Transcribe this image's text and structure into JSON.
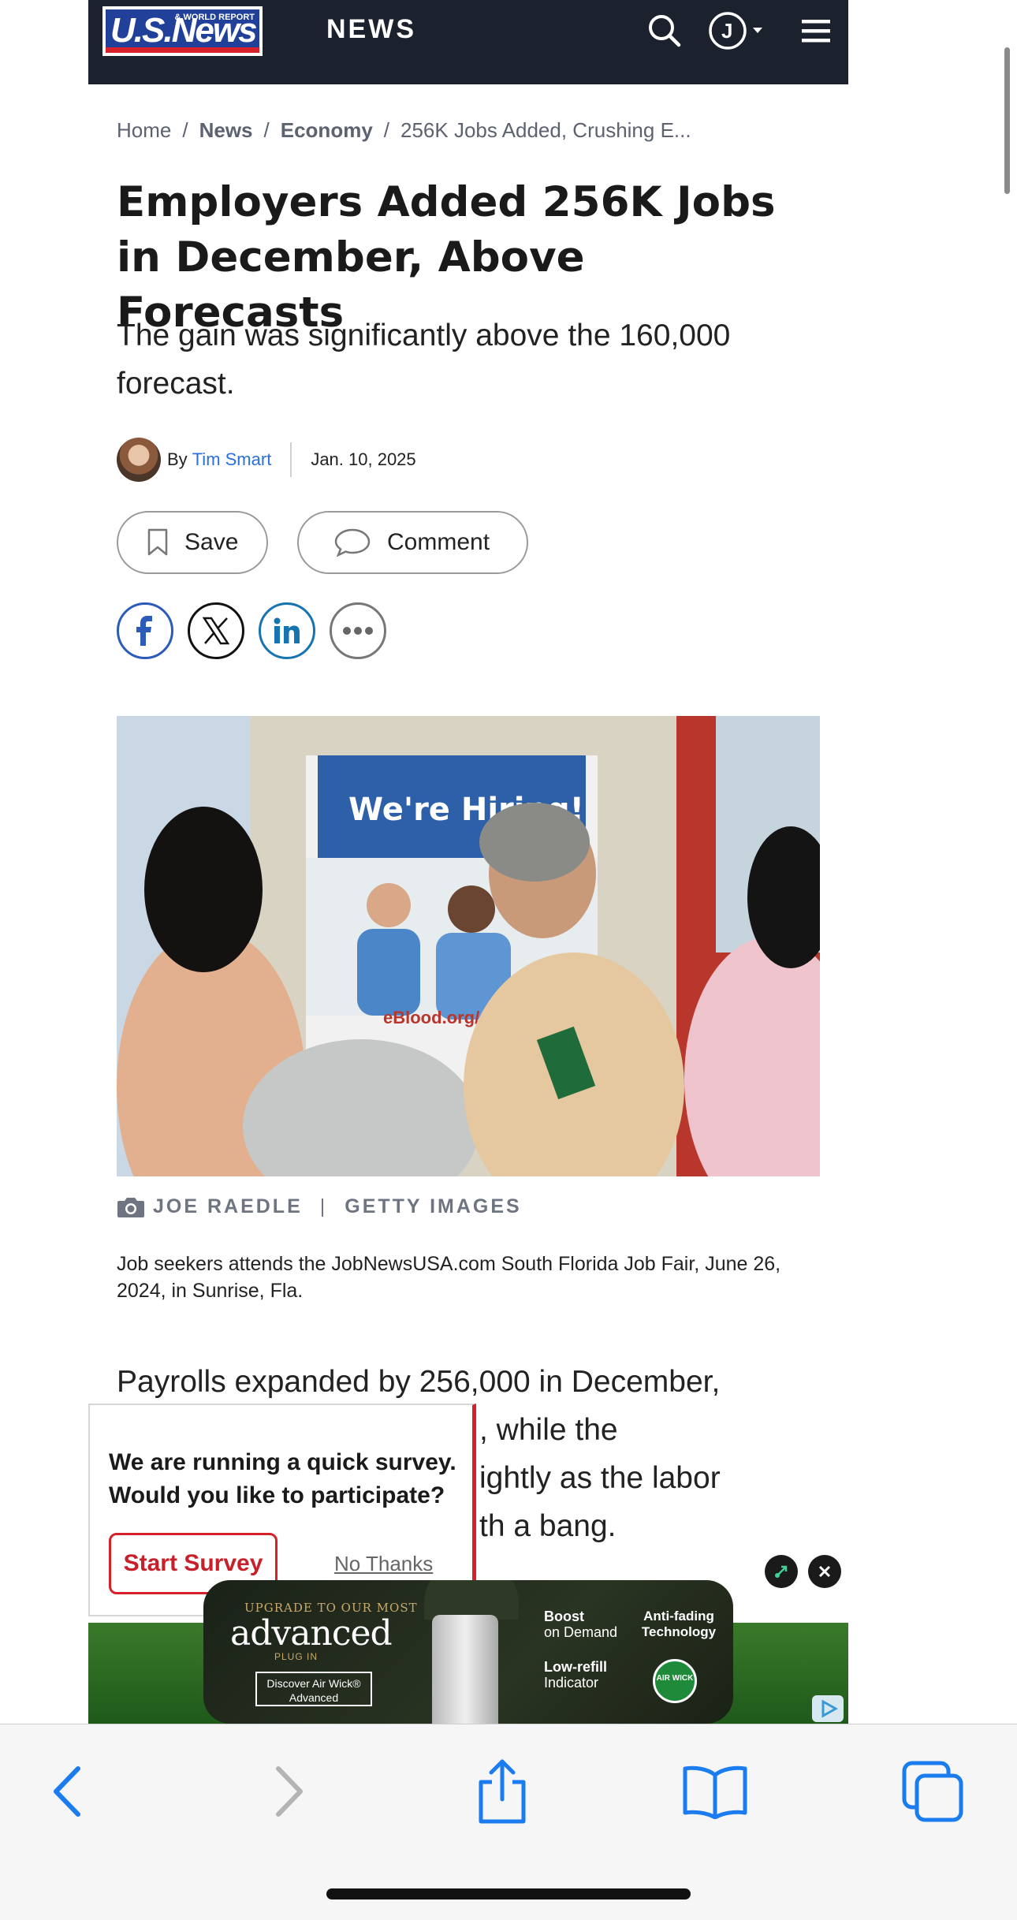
{
  "header": {
    "logo_text": "U.S.News",
    "logo_subtext": "& WORLD REPORT",
    "section": "NEWS",
    "account_initial": "J",
    "icons": [
      "search-icon",
      "account-icon",
      "menu-icon"
    ]
  },
  "breadcrumb": {
    "items": [
      "Home",
      "News",
      "Economy",
      "256K Jobs Added, Crushing E..."
    ],
    "separator": "/"
  },
  "article": {
    "headline": "Employers Added 256K Jobs in December, Above Forecasts",
    "dek": "The gain was significantly above the 160,000 forecast.",
    "byline_prefix": "By",
    "author": "Tim Smart",
    "date": "Jan. 10, 2025",
    "save_label": "Save",
    "comment_label": "Comment",
    "share_icons": [
      "facebook-icon",
      "x-icon",
      "linkedin-icon",
      "more-icon"
    ],
    "image_credit_photographer": "JOE RAEDLE",
    "image_credit_agency": "GETTY IMAGES",
    "image_banner_text": "We're Hiring!",
    "image_sign_text": "eBlood.org/careers",
    "caption": "Job seekers attends the JobNewsUSA.com South Florida Job Fair, June 26, 2024, in Sunrise, Fla.",
    "body_line1": "Payrolls expanded by 256,000 in December,",
    "body_line2": ", while the",
    "body_line3": "ightly as the labor",
    "body_line4": "th a bang."
  },
  "survey": {
    "question": "We are running a quick survey. Would you like to participate?",
    "start_label": "Start Survey",
    "no_thanks_label": "No Thanks"
  },
  "ad": {
    "line1": "UPGRADE TO OUR MOST",
    "line2": "advanced",
    "line3": "PLUG IN",
    "button": "Discover Air Wick® Advanced",
    "feature1_title": "Boost",
    "feature1_sub": "on Demand",
    "feature2_title": "Low-refill",
    "feature2_sub": "Indicator",
    "feature3": "Anti-fading Technology",
    "brand": "AIR WICK"
  },
  "colors": {
    "header_bg": "#1c212e",
    "link_blue": "#2a6fdb",
    "survey_red": "#d6202a",
    "facebook": "#2d5bb8",
    "linkedin": "#1674b0"
  },
  "toolbar": {
    "icons": [
      "back-icon",
      "forward-icon",
      "share-icon",
      "bookmarks-icon",
      "tabs-icon"
    ]
  }
}
